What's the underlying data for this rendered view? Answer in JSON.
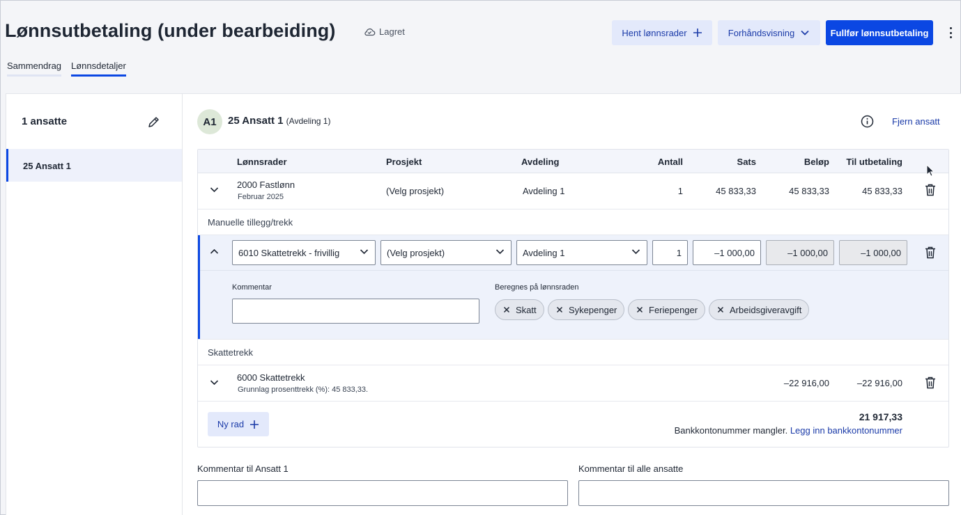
{
  "header": {
    "title": "Lønnsutbetaling (under bearbeiding)",
    "saved_status": "Lagret",
    "fetch_rows_label": "Hent lønnsrader",
    "preview_label": "Forhåndsvisning",
    "complete_label": "Fullfør lønnsutbetaling"
  },
  "tabs": [
    {
      "label": "Sammendrag",
      "active": false
    },
    {
      "label": "Lønnsdetaljer",
      "active": true
    }
  ],
  "sidebar": {
    "count_label": "1 ansatte",
    "employees": [
      {
        "label": "25 Ansatt 1",
        "selected": true
      }
    ]
  },
  "employee": {
    "initials": "A1",
    "name": "25 Ansatt 1",
    "department": "(Avdeling 1)",
    "remove_label": "Fjern ansatt"
  },
  "table": {
    "columns": [
      "Lønnsrader",
      "Prosjekt",
      "Avdeling",
      "Antall",
      "Sats",
      "Beløp",
      "Til utbetaling"
    ],
    "rows": [
      {
        "code": "2000 Fastlønn",
        "period": "Februar 2025",
        "project": "(Velg prosjekt)",
        "department": "Avdeling 1",
        "quantity": "1",
        "rate": "45 833,33",
        "amount": "45 833,33",
        "payout": "45 833,33"
      }
    ],
    "manual_section_label": "Manuelle tillegg/trekk",
    "manual_row": {
      "code": "6010 Skattetrekk - frivillig",
      "project": "(Velg prosjekt)",
      "department": "Avdeling 1",
      "quantity": "1",
      "rate": "–1 000,00",
      "amount": "–1 000,00",
      "payout": "–1 000,00",
      "comment_label": "Kommentar",
      "comment_value": "",
      "calc_label": "Beregnes på lønnsraden",
      "chips": [
        "Skatt",
        "Sykepenger",
        "Feriepenger",
        "Arbeidsgiveravgift"
      ]
    },
    "tax_section_label": "Skattetrekk",
    "tax_row": {
      "code": "6000 Skattetrekk",
      "basis": "Grunnlag prosenttrekk (%): 45 833,33.",
      "amount": "–22 916,00",
      "payout": "–22 916,00"
    },
    "new_row_label": "Ny rad",
    "total": "21 917,33",
    "bank_missing": "Bankkontonummer mangler.",
    "bank_link": "Legg inn bankkontonummer"
  },
  "comments": {
    "employee_label": "Kommentar til Ansatt 1",
    "all_label": "Kommentar til alle ansatte"
  },
  "colors": {
    "primary": "#0b47e3",
    "secondary_bg": "#e3e9fb",
    "link": "#1a3aa8"
  }
}
